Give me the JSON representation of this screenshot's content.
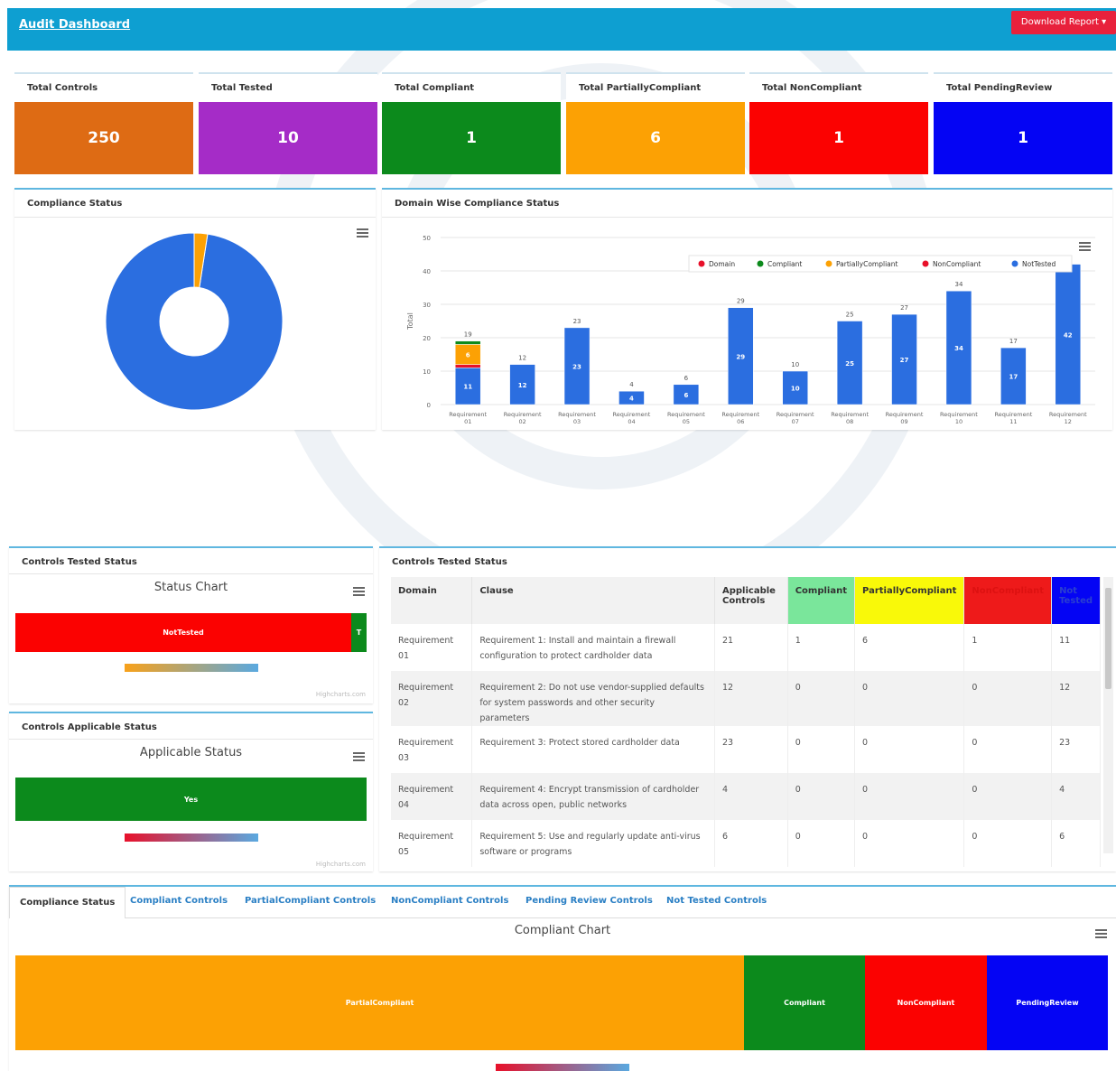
{
  "header": {
    "title": "Audit Dashboard",
    "download_label": "Download Report ▾"
  },
  "colors": {
    "header": "#0e9fd1",
    "total_controls": "#de6b14",
    "total_tested": "#a52cc7",
    "compliant": "#0c8a1c",
    "partially_compliant": "#fca104",
    "noncompliant": "#fb0201",
    "pending_review": "#0404f4",
    "not_tested": "#2b6ee0"
  },
  "stats": [
    {
      "label": "Total Controls",
      "value": "250"
    },
    {
      "label": "Total Tested",
      "value": "10"
    },
    {
      "label": "Total Compliant",
      "value": "1"
    },
    {
      "label": "Total PartiallyCompliant",
      "value": "6"
    },
    {
      "label": "Total NonCompliant",
      "value": "1"
    },
    {
      "label": "Total PendingReview",
      "value": "1"
    }
  ],
  "compliance_status": {
    "title": "Compliance Status",
    "slices": [
      {
        "name": "NotTested",
        "value": 240,
        "color": "#2b6ee0"
      },
      {
        "name": "PartiallyCompliant",
        "value": 6,
        "color": "#fca104"
      }
    ]
  },
  "chart_data": [
    {
      "type": "bar",
      "title": "Domain Wise Compliance Status",
      "ylabel": "Total",
      "ylim": [
        0,
        50
      ],
      "yticks": [
        "0",
        "10",
        "20",
        "30",
        "40",
        "50"
      ],
      "categories": [
        "Requirement 01",
        "Requirement 02",
        "Requirement 03",
        "Requirement 04",
        "Requirement 05",
        "Requirement 06",
        "Requirement 07",
        "Requirement 08",
        "Requirement 09",
        "Requirement 10",
        "Requirement 11",
        "Requirement 12"
      ],
      "legend": [
        "Domain",
        "Compliant",
        "PartiallyCompliant",
        "NonCompliant",
        "NotTested"
      ],
      "legend_colors": [
        "#e8102a",
        "#0c8a1c",
        "#fca104",
        "#e8102a",
        "#2b6ee0"
      ],
      "series": [
        {
          "name": "NotTested",
          "values": [
            11,
            12,
            23,
            4,
            6,
            29,
            10,
            25,
            27,
            34,
            17,
            42
          ]
        },
        {
          "name": "NonCompliant",
          "values": [
            1,
            0,
            0,
            0,
            0,
            0,
            0,
            0,
            0,
            0,
            0,
            0
          ]
        },
        {
          "name": "PartiallyCompliant",
          "values": [
            6,
            0,
            0,
            0,
            0,
            0,
            0,
            0,
            0,
            0,
            0,
            0
          ]
        },
        {
          "name": "Compliant",
          "values": [
            1,
            0,
            0,
            0,
            0,
            0,
            0,
            0,
            0,
            0,
            0,
            0
          ]
        }
      ],
      "totals": [
        "19",
        "12",
        "23",
        "4",
        "6",
        "29",
        "10",
        "25",
        "27",
        "34",
        "17",
        ""
      ]
    },
    {
      "type": "bar",
      "title": "Status Chart",
      "segments": [
        {
          "label": "NotTested",
          "value": 240
        },
        {
          "label": "T",
          "value": 10
        }
      ]
    },
    {
      "type": "bar",
      "title": "Applicable Status",
      "segments": [
        {
          "label": "Yes",
          "value": 250
        }
      ]
    },
    {
      "type": "bar",
      "title": "Compliant Chart",
      "segments": [
        {
          "label": "PartialCompliant",
          "value": 6
        },
        {
          "label": "Compliant",
          "value": 1
        },
        {
          "label": "NonCompliant",
          "value": 1
        },
        {
          "label": "PendingReview",
          "value": 1
        }
      ]
    }
  ],
  "panels": {
    "compliance_status": "Compliance Status",
    "domain_wise": "Domain Wise Compliance Status",
    "controls_tested": "Controls Tested Status",
    "controls_applicable": "Controls Applicable Status",
    "controls_tested_table": "Controls Tested Status",
    "highcharts_credit": "Highcharts.com"
  },
  "table": {
    "headers": [
      "Domain",
      "Clause",
      "Applicable Controls",
      "Compliant",
      "PartiallyCompliant",
      "NonCompliant",
      "Not Tested"
    ],
    "rows": [
      [
        "Requirement 01",
        "Requirement 1: Install and maintain a firewall configuration to protect cardholder data",
        "21",
        "1",
        "6",
        "1",
        "11"
      ],
      [
        "Requirement 02",
        "Requirement 2: Do not use vendor-supplied defaults for system passwords and other security parameters",
        "12",
        "0",
        "0",
        "0",
        "12"
      ],
      [
        "Requirement 03",
        "Requirement 3: Protect stored cardholder data",
        "23",
        "0",
        "0",
        "0",
        "23"
      ],
      [
        "Requirement 04",
        "Requirement 4: Encrypt transmission of cardholder data across open, public networks",
        "4",
        "0",
        "0",
        "0",
        "4"
      ],
      [
        "Requirement 05",
        "Requirement 5: Use and regularly update anti-virus software or programs",
        "6",
        "0",
        "0",
        "0",
        "6"
      ]
    ]
  },
  "tabs": [
    "Compliance Status",
    "Compliant Controls",
    "PartialCompliant Controls",
    "NonCompliant Controls",
    "Pending Review Controls",
    "Not Tested Controls"
  ]
}
